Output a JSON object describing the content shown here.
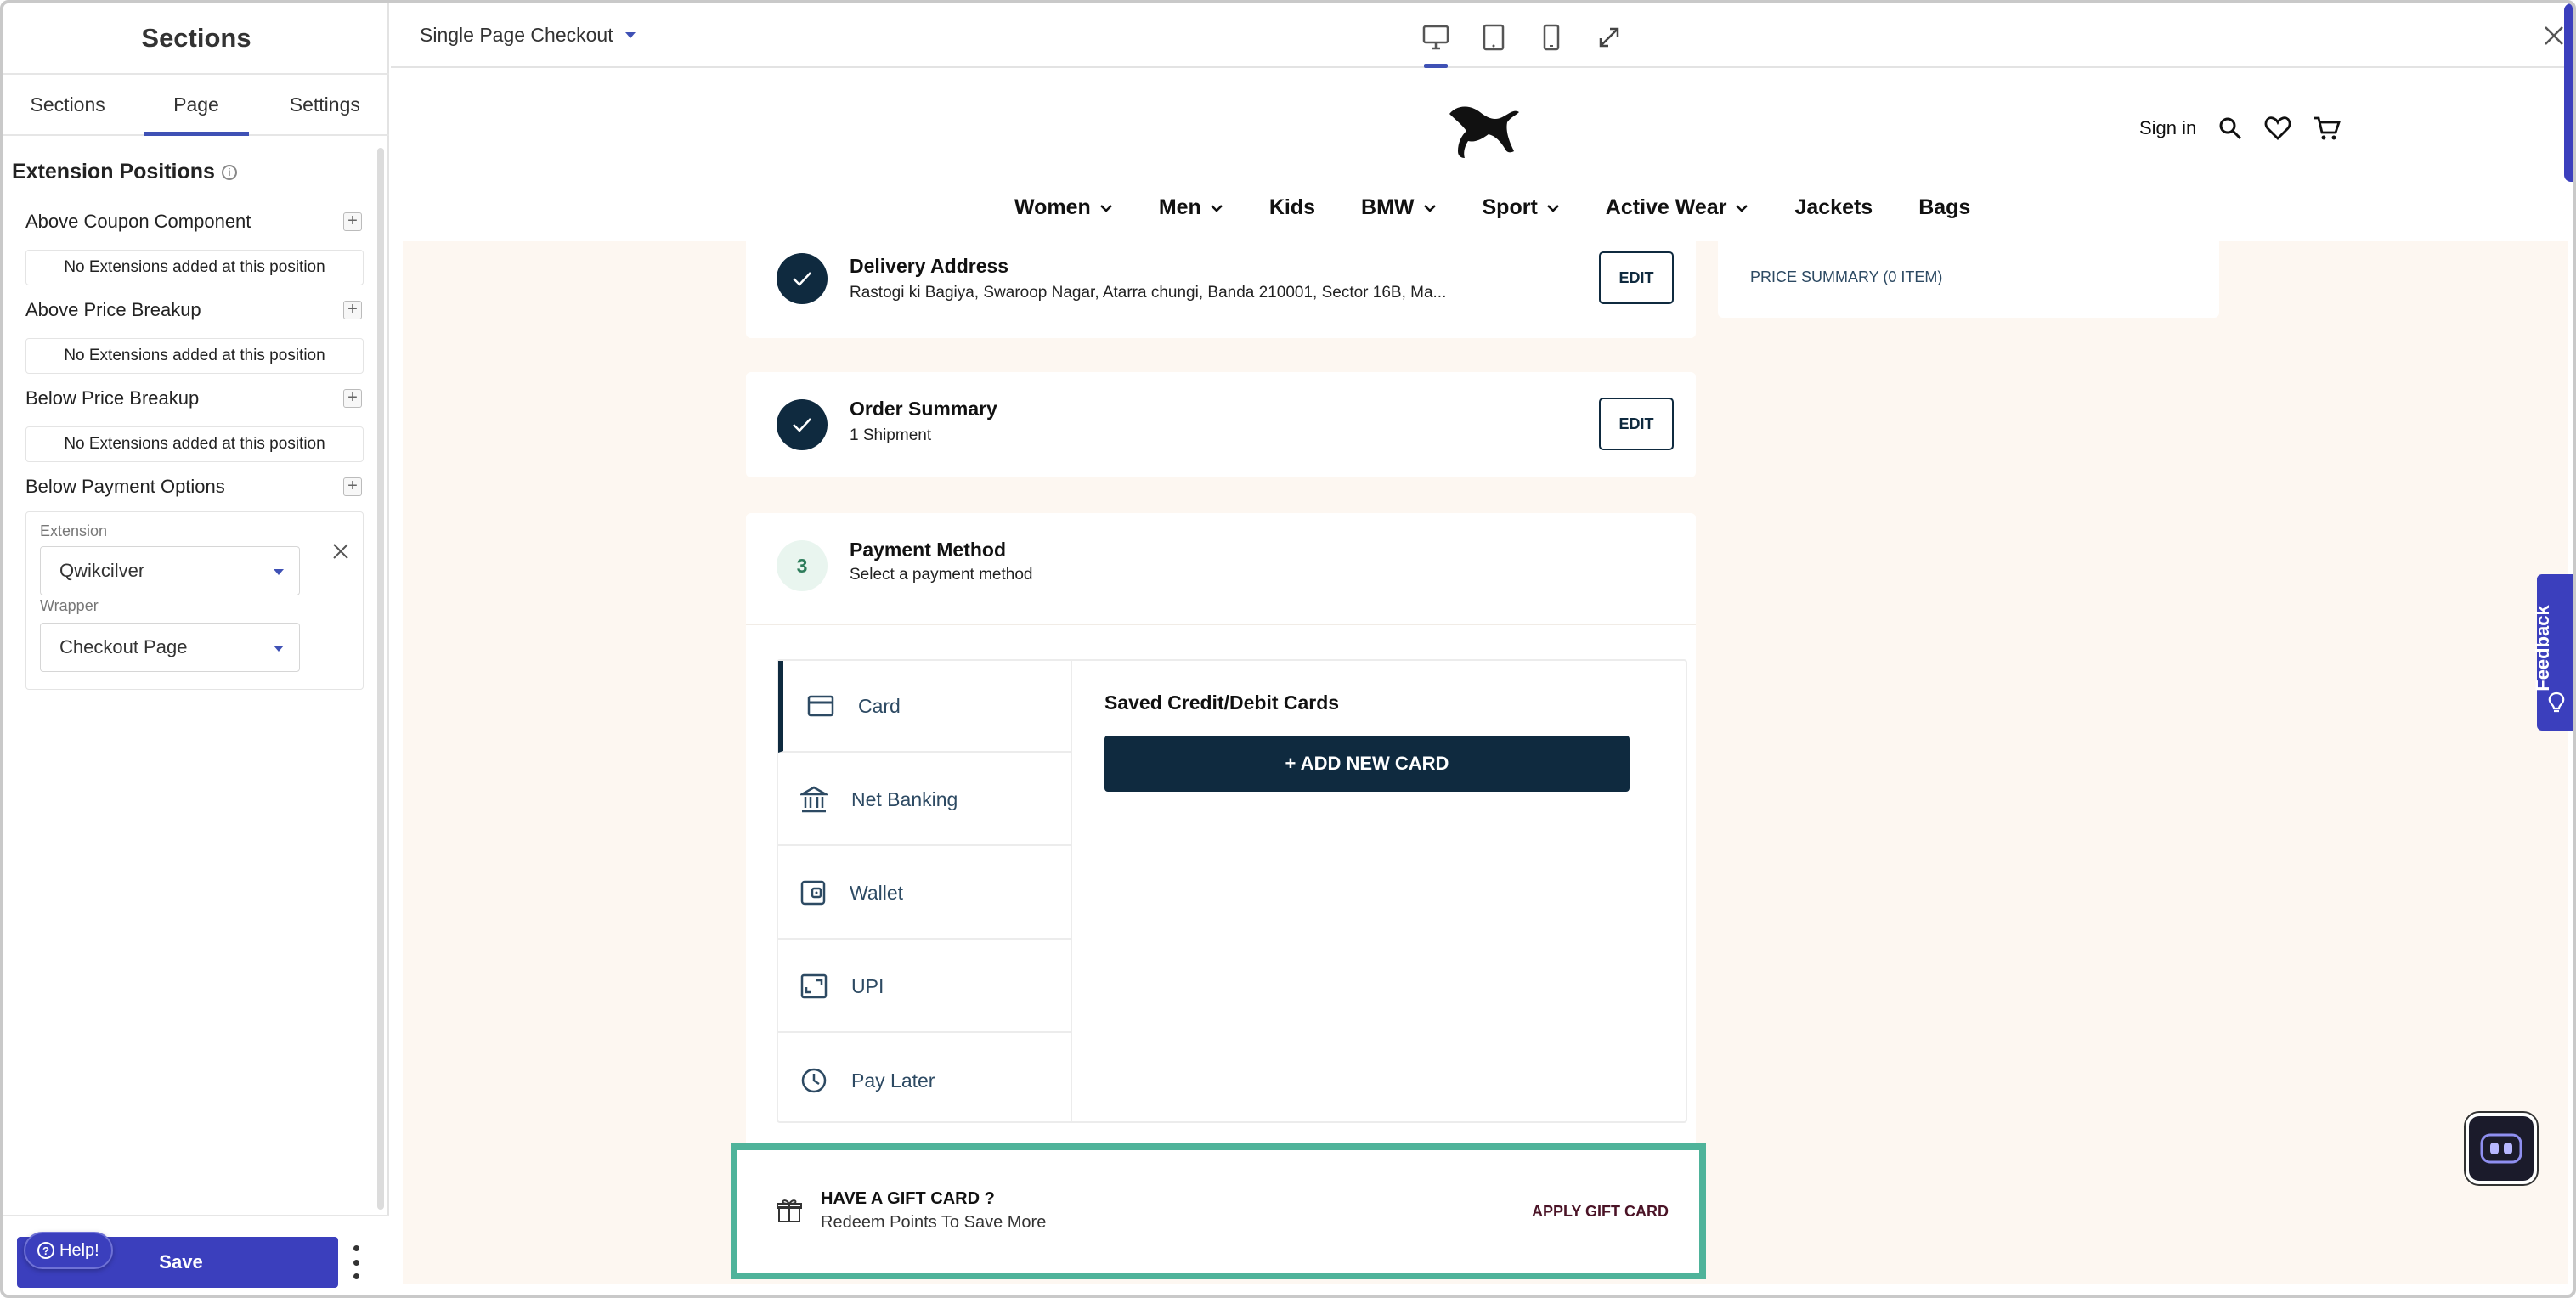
{
  "sidebar": {
    "title": "Sections",
    "tabs": [
      "Sections",
      "Page",
      "Settings"
    ],
    "active_tab": "Page",
    "extension_positions_title": "Extension Positions",
    "positions": [
      {
        "label": "Above Coupon Component",
        "empty_text": "No Extensions added at this position"
      },
      {
        "label": "Above Price Breakup",
        "empty_text": "No Extensions added at this position"
      },
      {
        "label": "Below Price Breakup",
        "empty_text": "No Extensions added at this position"
      },
      {
        "label": "Below Payment Options"
      }
    ],
    "extension_card": {
      "extension_label": "Extension",
      "extension_value": "Qwikcilver",
      "wrapper_label": "Wrapper",
      "wrapper_value": "Checkout Page"
    },
    "footer": {
      "help_label": "Help!",
      "save_label": "Save"
    }
  },
  "toolbar": {
    "page_name": "Single Page Checkout"
  },
  "store": {
    "header": {
      "sign_in": "Sign in"
    },
    "nav": [
      {
        "label": "Women",
        "dropdown": true
      },
      {
        "label": "Men",
        "dropdown": true
      },
      {
        "label": "Kids",
        "dropdown": false
      },
      {
        "label": "BMW",
        "dropdown": true
      },
      {
        "label": "Sport",
        "dropdown": true
      },
      {
        "label": "Active Wear",
        "dropdown": true
      },
      {
        "label": "Jackets",
        "dropdown": false
      },
      {
        "label": "Bags",
        "dropdown": false
      }
    ],
    "delivery": {
      "title": "Delivery Address",
      "address": "Rastogi ki Bagiya, Swaroop Nagar, Atarra chungi, Banda 210001, Sector 16B, Ma...",
      "edit": "EDIT"
    },
    "order_summary": {
      "title": "Order Summary",
      "subtitle": "1 Shipment",
      "edit": "EDIT"
    },
    "payment": {
      "step": "3",
      "title": "Payment Method",
      "subtitle": "Select a payment method",
      "methods": [
        "Card",
        "Net Banking",
        "Wallet",
        "UPI",
        "Pay Later"
      ],
      "saved_title": "Saved Credit/Debit Cards",
      "add_card": "+ ADD NEW CARD"
    },
    "price_summary": "PRICE SUMMARY (0 ITEM)",
    "gift_card": {
      "title": "HAVE A GIFT CARD ?",
      "subtitle": "Redeem Points To Save More",
      "apply": "APPLY GIFT CARD"
    }
  },
  "feedback_label": "Feedback",
  "colors": {
    "primary": "#3b3fbd",
    "navy": "#0f2a3f",
    "highlight": "#4fb39a",
    "preview_bg": "#fdf7f1"
  }
}
